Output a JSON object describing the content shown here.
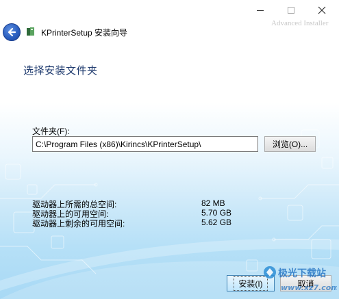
{
  "window": {
    "title": "KPrinterSetup 安装向导",
    "brand": "Advanced Installer",
    "controls": {
      "minimize": "—",
      "maximize": "☐",
      "close": "✕"
    }
  },
  "page": {
    "heading": "选择安装文件夹",
    "folder_label": "文件夹(F):",
    "folder_path": "C:\\Program Files (x86)\\Kirincs\\KPrinterSetup\\",
    "browse_label": "浏览(O)...",
    "space": [
      {
        "label": "驱动器上所需的总空间:",
        "value": "82 MB"
      },
      {
        "label": "驱动器上的可用空间:",
        "value": "5.70 GB"
      },
      {
        "label": "驱动器上剩余的可用空间:",
        "value": "5.62 GB"
      }
    ]
  },
  "footer": {
    "install_label": "安装(I)",
    "cancel_label": "取消"
  },
  "watermark": {
    "text": "极光下载站",
    "url": "www.xz7.com"
  },
  "colors": {
    "heading": "#1e3a6e",
    "back_button": "#2b5fc0",
    "background_blue": "#a8d9f5"
  }
}
